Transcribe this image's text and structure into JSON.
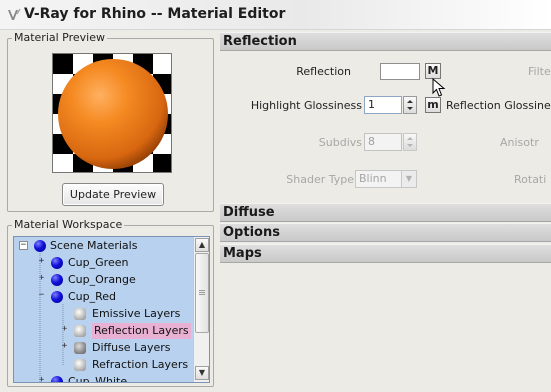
{
  "window": {
    "title": "V-Ray for Rhino -- Material Editor"
  },
  "preview": {
    "group_label": "Material Preview",
    "update_button": "Update Preview"
  },
  "workspace": {
    "group_label": "Material Workspace",
    "tree": [
      {
        "label": "Scene Materials",
        "expander": "−"
      },
      {
        "label": "Cup_Green",
        "expander": "+"
      },
      {
        "label": "Cup_Orange",
        "expander": "+"
      },
      {
        "label": "Cup_Red",
        "expander": "−"
      },
      {
        "label": "Emissive Layers"
      },
      {
        "label": "Reflection Layers",
        "expander": "+"
      },
      {
        "label": "Diffuse Layers",
        "expander": "+"
      },
      {
        "label": "Refraction Layers"
      },
      {
        "label": "Cup_White",
        "expander": "+"
      }
    ]
  },
  "sections": {
    "reflection": "Reflection",
    "diffuse": "Diffuse",
    "options": "Options",
    "maps": "Maps"
  },
  "reflection": {
    "reflection_label": "Reflection",
    "map_button": "M",
    "filter_label_partial": "Filte",
    "highlight_glossiness_label": "Highlight Glossiness",
    "highlight_glossiness_value": "1",
    "map_button_small": "m",
    "reflection_glossiness_label_partial": "Reflection Glossines",
    "subdivs_label": "Subdivs",
    "subdivs_value": "8",
    "anisotropy_label_partial": "Anisotr",
    "shader_type_label": "Shader Type",
    "shader_type_value": "Blinn",
    "rotation_label_partial": "Rotati"
  },
  "colors": {
    "tree_background": "#b8d1ee",
    "selection": "#e8b0d2",
    "sphere": "#f07d16"
  },
  "icons": {
    "title": "vray-logo-icon",
    "material": "blue-sphere-icon",
    "layer": "layer-sphere-icon",
    "cursor": "mouse-pointer-icon"
  }
}
